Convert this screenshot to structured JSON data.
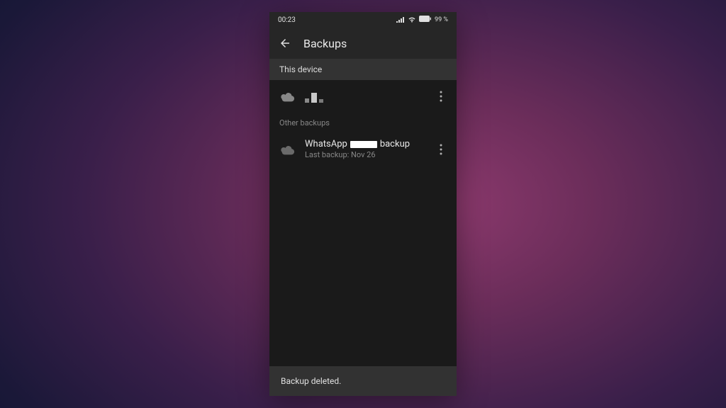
{
  "status_bar": {
    "time": "00:23",
    "battery": "99 %"
  },
  "app_bar": {
    "title": "Backups"
  },
  "sections": {
    "this_device": "This device",
    "other_backups": "Other backups"
  },
  "backups": {
    "device": {
      "title_hidden": true
    },
    "whatsapp": {
      "title_prefix": "WhatsApp",
      "title_suffix": "backup",
      "subtitle": "Last backup: Nov 26"
    }
  },
  "snackbar": {
    "message": "Backup deleted."
  }
}
